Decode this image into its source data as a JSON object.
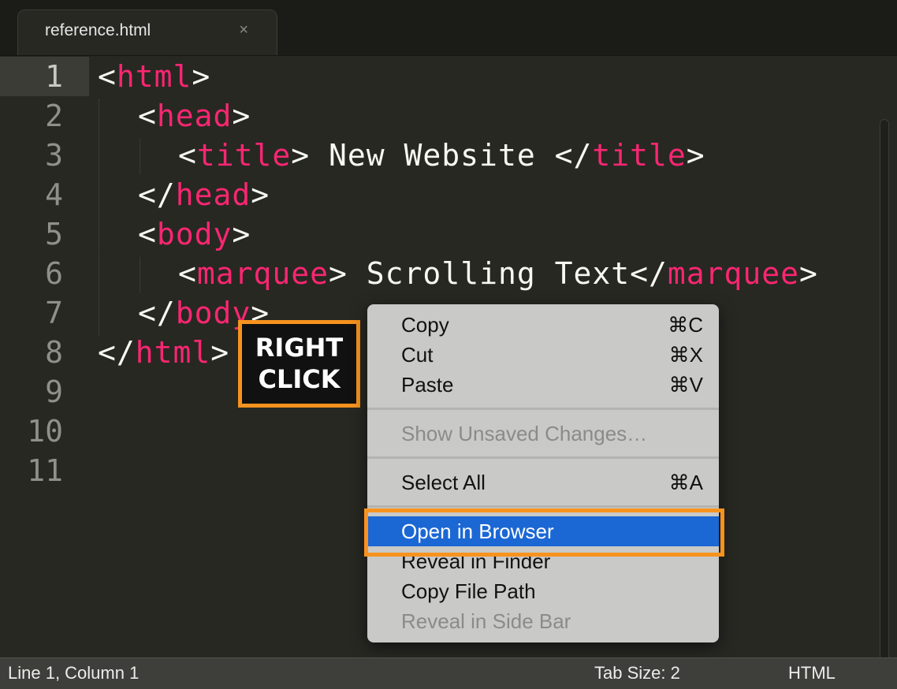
{
  "tab": {
    "title": "reference.html",
    "close_glyph": "×"
  },
  "editor": {
    "lines": [
      {
        "number": "1"
      },
      {
        "number": "2"
      },
      {
        "number": "3"
      },
      {
        "number": "4"
      },
      {
        "number": "5"
      },
      {
        "number": "6"
      },
      {
        "number": "7"
      },
      {
        "number": "8"
      },
      {
        "number": "9"
      },
      {
        "number": "10"
      },
      {
        "number": "11"
      }
    ],
    "code": {
      "l1": {
        "open": "<",
        "tag": "html",
        "close": ">"
      },
      "l2": {
        "open": "<",
        "tag": "head",
        "close": ">"
      },
      "l3": {
        "open": "<",
        "tag": "title",
        "mid": "> New Website </",
        "tag2": "title",
        "close": ">"
      },
      "l4": {
        "open": "</",
        "tag": "head",
        "close": ">"
      },
      "l5": {
        "open": "<",
        "tag": "body",
        "close": ">"
      },
      "l6": {
        "open": "<",
        "tag": "marquee",
        "mid": "> Scrolling Text</",
        "tag2": "marquee",
        "close": ">"
      },
      "l7": {
        "open": "</",
        "tag": "body",
        "close": ">"
      },
      "l8": {
        "open": "</",
        "tag": "html",
        "close": ">"
      }
    },
    "colors": {
      "background": "#272822",
      "tag": "#f92672",
      "text": "#f8f8f2"
    }
  },
  "annotation": {
    "line1": "RIGHT",
    "line2": "CLICK",
    "color": "#f7931e"
  },
  "context_menu": {
    "copy": {
      "label": "Copy",
      "shortcut": "⌘C"
    },
    "cut": {
      "label": "Cut",
      "shortcut": "⌘X"
    },
    "paste": {
      "label": "Paste",
      "shortcut": "⌘V"
    },
    "show_unsaved": {
      "label": "Show Unsaved Changes…"
    },
    "select_all": {
      "label": "Select All",
      "shortcut": "⌘A"
    },
    "open_in_browser": {
      "label": "Open in Browser"
    },
    "reveal_in_finder": {
      "label": "Reveal in Finder"
    },
    "copy_file_path": {
      "label": "Copy File Path"
    },
    "reveal_in_side_bar": {
      "label": "Reveal in Side Bar"
    },
    "highlight_color": "#1b67d4"
  },
  "status_bar": {
    "position": "Line 1, Column 1",
    "tab_size": "Tab Size: 2",
    "syntax": "HTML"
  }
}
